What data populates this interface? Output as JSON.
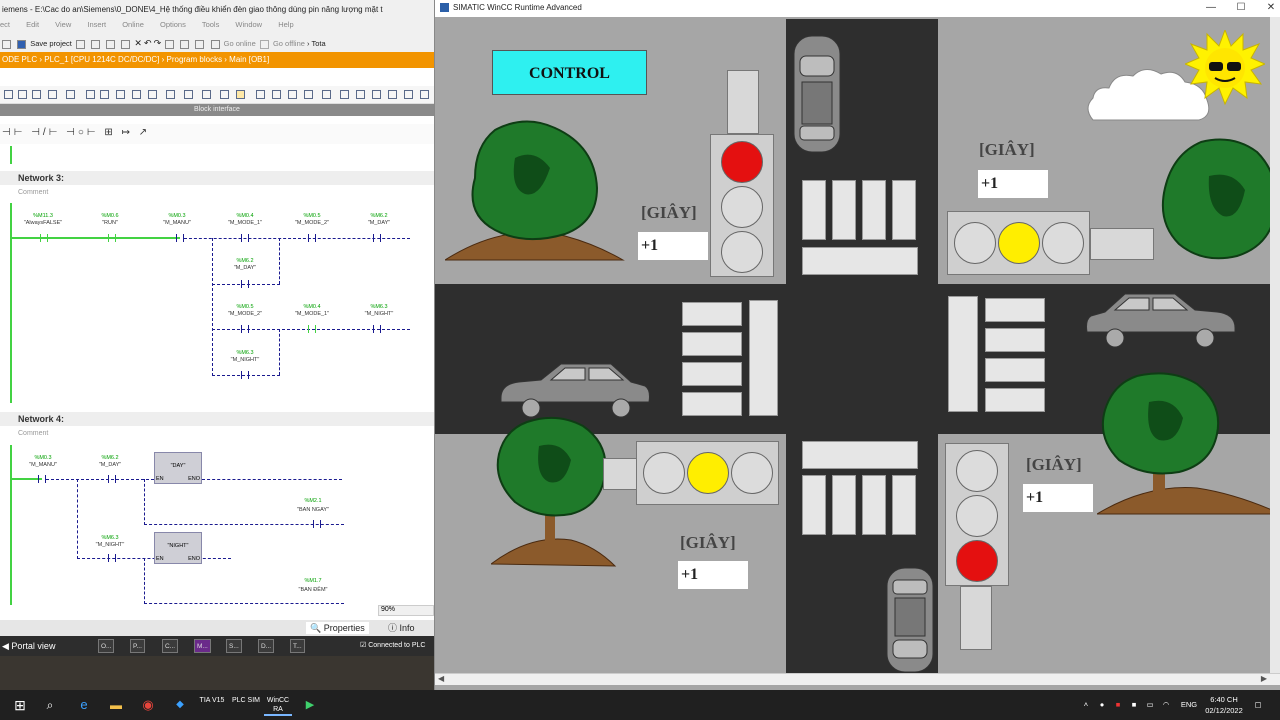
{
  "tia": {
    "title": "iemens - E:\\Cac do an\\Siemens\\0_DONE\\4_Hệ thống điều khiển đèn giao thông dùng pin năng lượng mặt t",
    "menu": [
      "ect",
      "Edit",
      "View",
      "Insert",
      "Online",
      "Options",
      "Tools",
      "Window",
      "Help"
    ],
    "toolbar": {
      "save": "Save project",
      "go_online": "Go online",
      "go_offline": "Go offline",
      "tota": "Tota"
    },
    "breadcrumb": "ODE PLC  ›  PLC_1 [CPU 1214C DC/DC/DC]  ›  Program blocks  ›  Main [OB1]",
    "block_interface": "Block interface",
    "ladder_tools": "⊣⊢ ⊣/⊢ ⊣○⊢ ⊞ ↦ ↗",
    "network3": {
      "title": "Network 3:",
      "comment": "Comment",
      "contacts": [
        {
          "addr": "%M11.3",
          "name": "\"AlwaysFALSE\""
        },
        {
          "addr": "%M0.6",
          "name": "\"RUN\""
        },
        {
          "addr": "%M0.3",
          "name": "\"M_MANU\""
        },
        {
          "addr": "%M0.4",
          "name": "\"M_MODE_1\""
        },
        {
          "addr": "%M0.5",
          "name": "\"M_MODE_2\""
        },
        {
          "addr": "%M6.2",
          "name": "\"M_DAY\""
        },
        {
          "addr": "%M6.2",
          "name": "\"M_DAY\""
        },
        {
          "addr": "%M0.5",
          "name": "\"M_MODE_2\""
        },
        {
          "addr": "%M0.4",
          "name": "\"M_MODE_1\""
        },
        {
          "addr": "%M6.3",
          "name": "\"M_NIGHT\""
        },
        {
          "addr": "%M6.3",
          "name": "\"M_NIGHT\""
        }
      ]
    },
    "network4": {
      "title": "Network 4:",
      "comment": "Comment",
      "contacts": [
        {
          "addr": "%M0.3",
          "name": "\"M_MANU\""
        },
        {
          "addr": "%M6.2",
          "name": "\"M_DAY\""
        },
        {
          "addr": "%M6.3",
          "name": "\"M_NIGHT\""
        },
        {
          "addr": "%M2.1",
          "name": "\"BAN NGAY\""
        },
        {
          "addr": "%M1.7",
          "name": "\"BAN ĐÊM\""
        }
      ],
      "block_day": "\"DAY\"",
      "block_night": "\"NIGHT\"",
      "en": "EN",
      "eno": "ENO"
    },
    "zoom": "90%",
    "properties": "Properties",
    "info": "Info",
    "portal_view": "Portal view",
    "bottom_tabs": [
      "O...",
      "P...",
      "C...",
      "M...",
      "S...",
      "D...",
      "T..."
    ],
    "connected": "Connected to PLC"
  },
  "wincc": {
    "title": "SIMATIC WinCC Runtime Advanced",
    "control_label": "CONTROL",
    "seconds_label": "[GIÂY]",
    "timers": {
      "north": "+1",
      "east": "+1",
      "west": "+1",
      "south": "+1"
    },
    "lights": {
      "north": "red",
      "east": "yellow",
      "west": "yellow",
      "south": "red"
    }
  },
  "taskbar": {
    "apps": [
      "TIA V15",
      "PLC SIM",
      "WinCC RA"
    ],
    "lang": "ENG",
    "time": "6:40 CH",
    "date": "02/12/2022"
  },
  "colors": {
    "orange": "#f29400",
    "cyan": "#2ef0f0",
    "red": "#e41010",
    "yellow": "#ffee00",
    "road": "#2e2e2e"
  }
}
